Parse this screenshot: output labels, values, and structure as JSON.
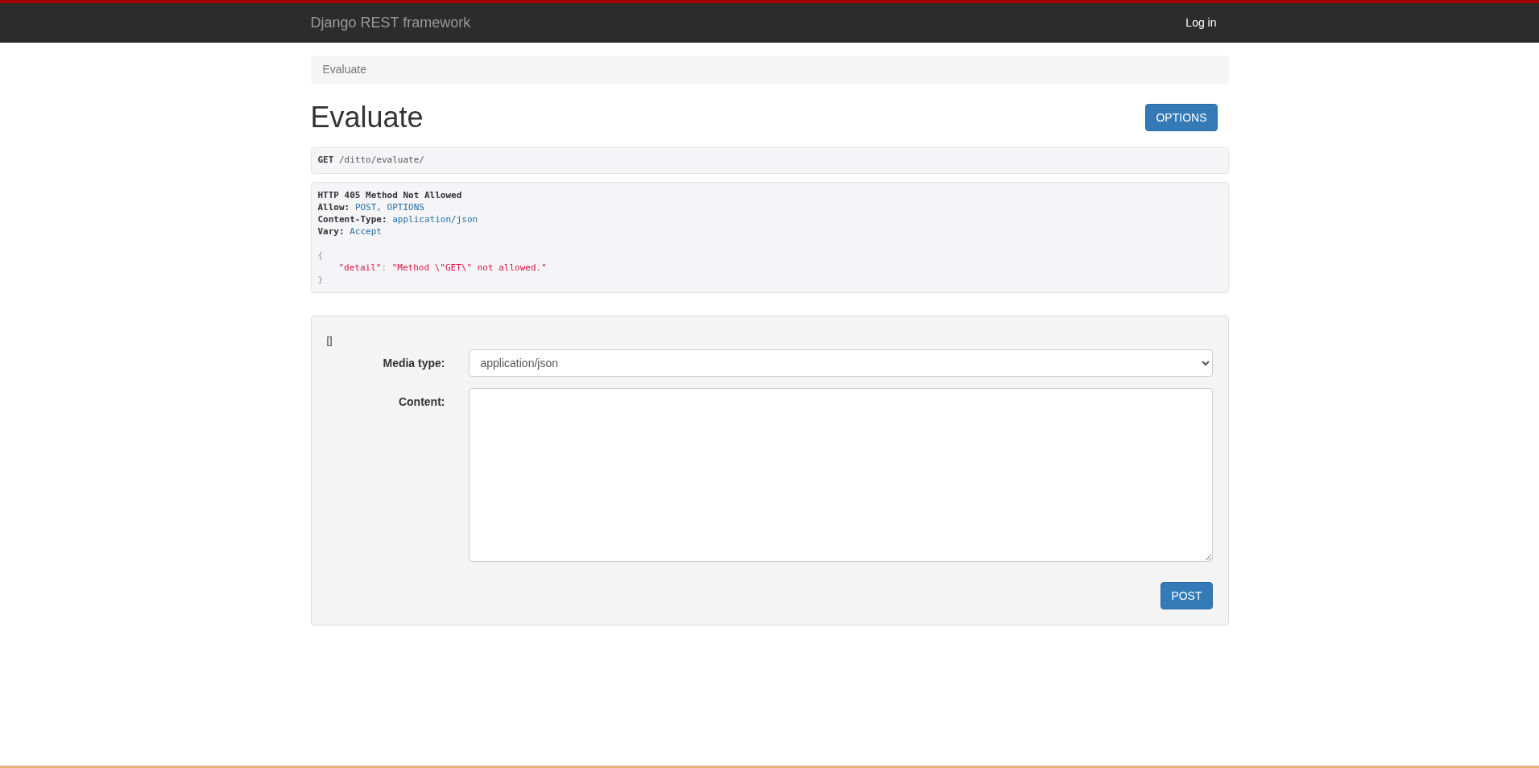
{
  "navbar": {
    "brand": "Django REST framework",
    "login": "Log in"
  },
  "breadcrumb": [
    {
      "label": "Evaluate",
      "selected": true
    }
  ],
  "page_title": "Evaluate",
  "options_button": "OPTIONS",
  "request": {
    "method": "GET",
    "path": "/ditto/evaluate/"
  },
  "response": {
    "status": "HTTP 405 Method Not Allowed",
    "headers": [
      {
        "name": "Allow:",
        "value": "POST, OPTIONS"
      },
      {
        "name": "Content-Type:",
        "value": "application/json"
      },
      {
        "name": "Vary:",
        "value": "Accept"
      }
    ],
    "body_open": "{",
    "body_key": "\"detail\"",
    "body_separator": ":",
    "body_value": "\"Method \\\"GET\\\" not allowed.\"",
    "body_close": "}"
  },
  "form": {
    "note": "[]",
    "media_type_label": "Media type:",
    "media_type_value": "application/json",
    "content_label": "Content:",
    "submit": "POST"
  }
}
